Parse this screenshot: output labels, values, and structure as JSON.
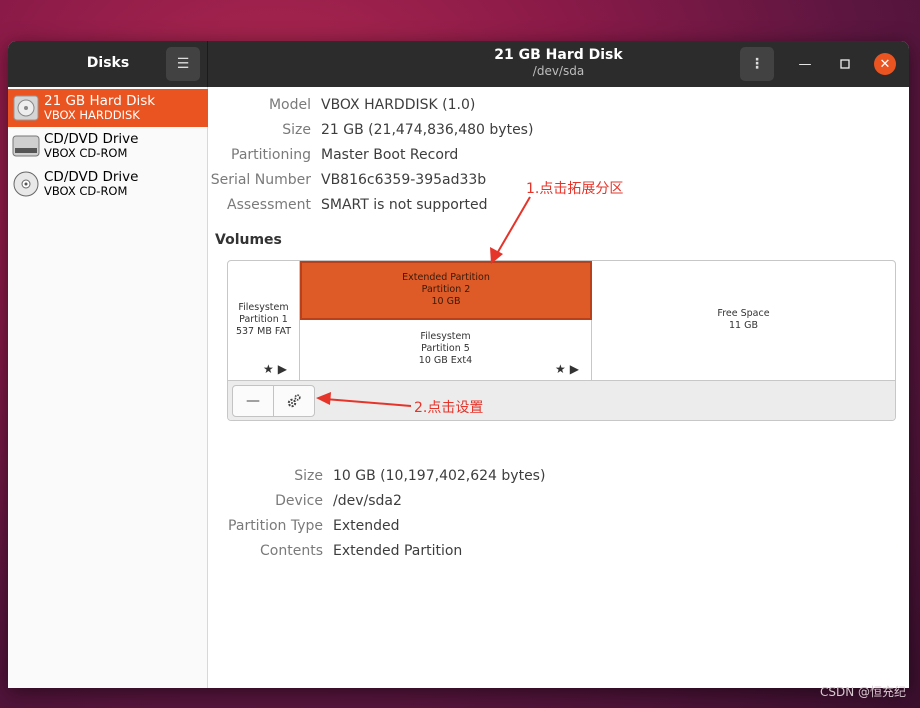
{
  "window": {
    "app_title": "Disks",
    "disk_title": "21 GB Hard Disk",
    "disk_path": "/dev/sda",
    "menu_icon": "hamburger-icon",
    "kebab_icon": "kebab-menu-icon"
  },
  "sidebar": {
    "items": [
      {
        "name": "21 GB Hard Disk",
        "sub": "VBOX HARDDISK",
        "icon": "hard-disk-icon"
      },
      {
        "name": "CD/DVD Drive",
        "sub": "VBOX CD-ROM",
        "icon": "optical-drive-icon"
      },
      {
        "name": "CD/DVD Drive",
        "sub": "VBOX CD-ROM",
        "icon": "optical-disc-icon"
      }
    ]
  },
  "disk_props": [
    {
      "label": "Model",
      "value": "VBOX HARDDISK (1.0)"
    },
    {
      "label": "Size",
      "value": "21 GB (21,474,836,480 bytes)"
    },
    {
      "label": "Partitioning",
      "value": "Master Boot Record"
    },
    {
      "label": "Serial Number",
      "value": "VB816c6359-395ad33b"
    },
    {
      "label": "Assessment",
      "value": "SMART is not supported"
    }
  ],
  "volumes": {
    "title": "Volumes",
    "partition1": {
      "line1": "Filesystem",
      "line2": "Partition 1",
      "line3": "537 MB FAT"
    },
    "extended": {
      "line1": "Extended Partition",
      "line2": "Partition 2",
      "line3": "10 GB"
    },
    "partition5": {
      "line1": "Filesystem",
      "line2": "Partition 5",
      "line3": "10 GB Ext4"
    },
    "free": {
      "line1": "Free Space",
      "line2": "11 GB"
    },
    "marks": "★▶",
    "minus_label": "—",
    "gear_icon": "gears-icon"
  },
  "volume_props": [
    {
      "label": "Size",
      "value": "10 GB (10,197,402,624 bytes)"
    },
    {
      "label": "Device",
      "value": "/dev/sda2"
    },
    {
      "label": "Partition Type",
      "value": "Extended"
    },
    {
      "label": "Contents",
      "value": "Extended Partition"
    }
  ],
  "annotations": {
    "step1": "1.点击拓展分区",
    "step2": "2.点击设置",
    "color": "#e5342a"
  },
  "watermark": "CSDN @恒充纪",
  "colors": {
    "accent": "#e95420",
    "titlebar": "#2c2c2c"
  }
}
